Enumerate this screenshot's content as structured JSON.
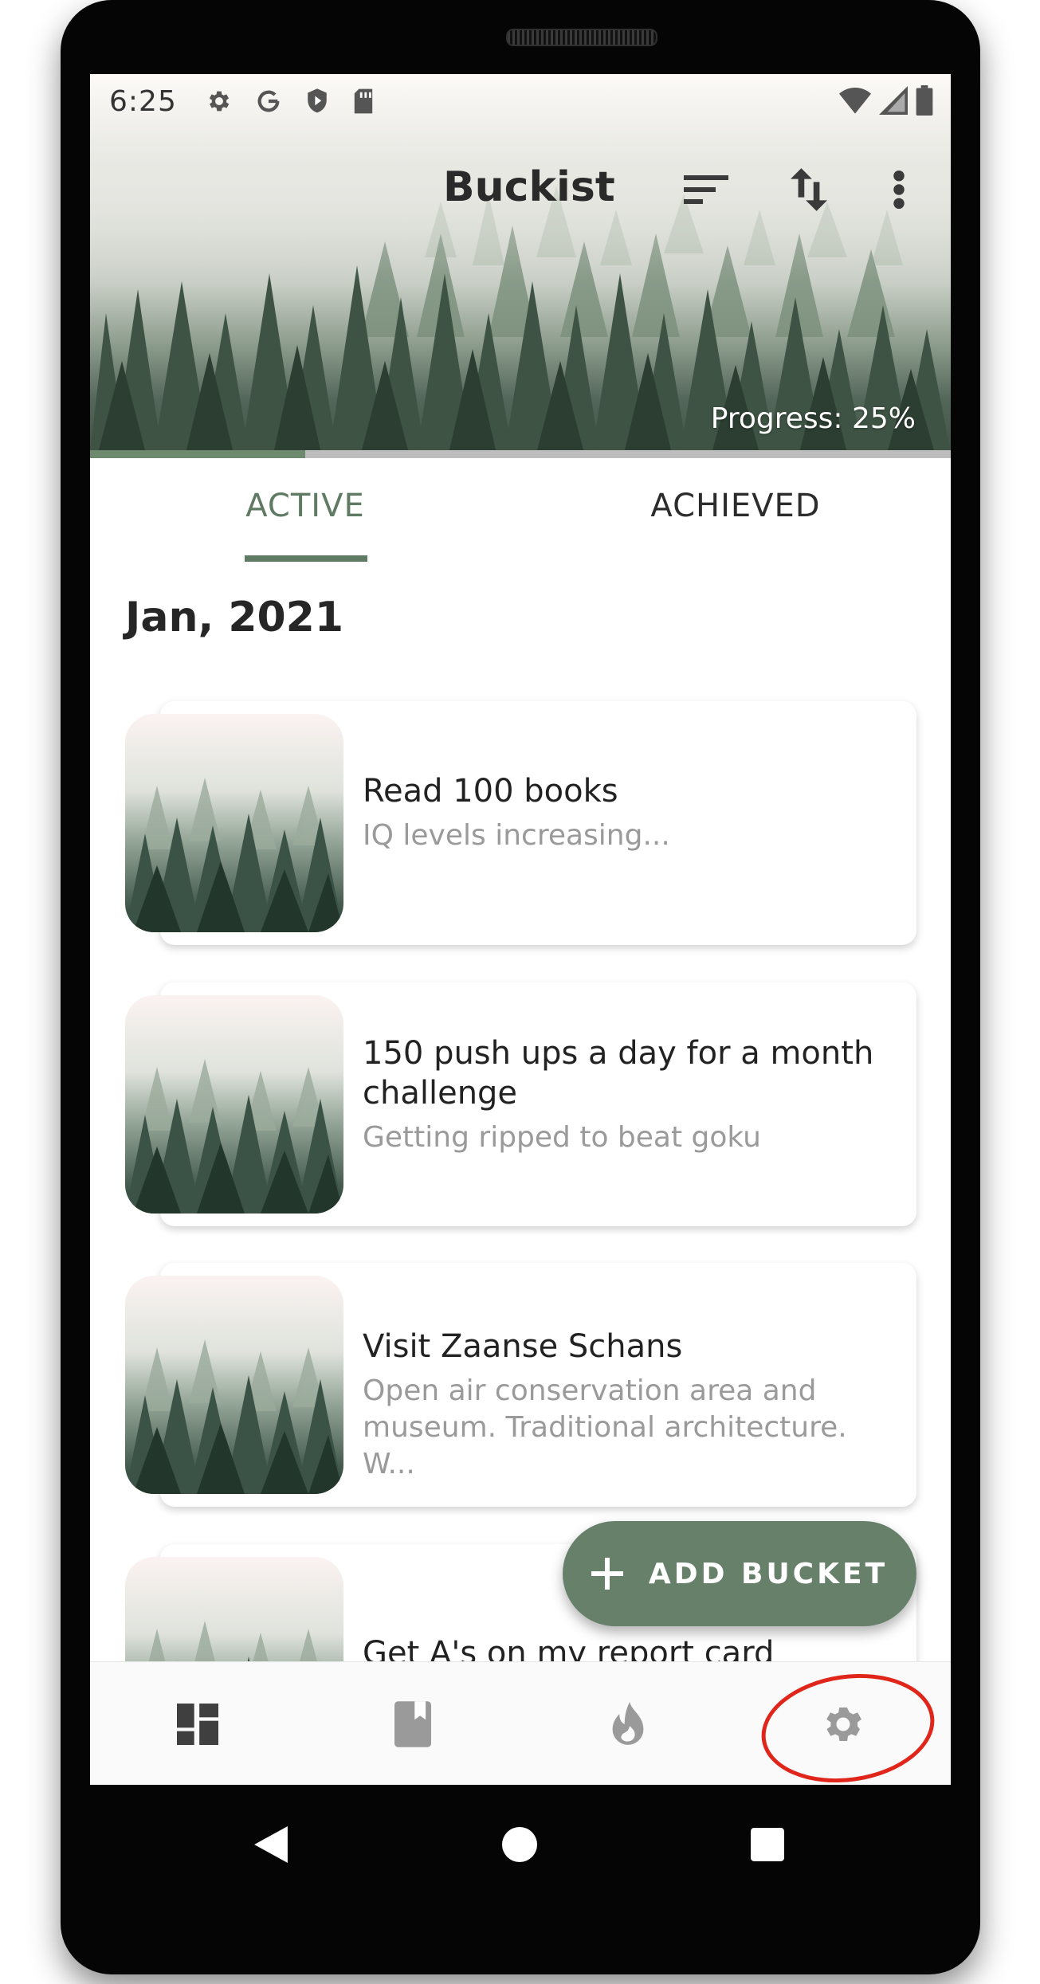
{
  "status_bar": {
    "time": "6:25"
  },
  "header": {
    "title": "Buckist",
    "progress_label": "Progress: 25%",
    "progress": 0.25
  },
  "tabs": [
    {
      "label": "ACTIVE",
      "active": true
    },
    {
      "label": "ACHIEVED",
      "active": false
    }
  ],
  "section": {
    "title": "Jan, 2021"
  },
  "cards": [
    {
      "title": "Read 100 books",
      "subtitle": "IQ levels increasing..."
    },
    {
      "title": "150 push ups a day for a month challenge",
      "subtitle": "Getting ripped to beat goku"
    },
    {
      "title": "Visit Zaanse Schans",
      "subtitle": "Open air conservation area and museum. Traditional architecture. W..."
    },
    {
      "title": "Get A's on my report card",
      "subtitle": ""
    }
  ],
  "fab": {
    "label": "ADD BUCKET"
  },
  "bottom_nav": [
    {
      "icon": "dashboard-icon"
    },
    {
      "icon": "book-icon"
    },
    {
      "icon": "flame-icon"
    },
    {
      "icon": "gear-icon"
    }
  ],
  "colors": {
    "accent": "#5f7b63",
    "fab": "#66806a",
    "annotation": "#e0251a"
  }
}
